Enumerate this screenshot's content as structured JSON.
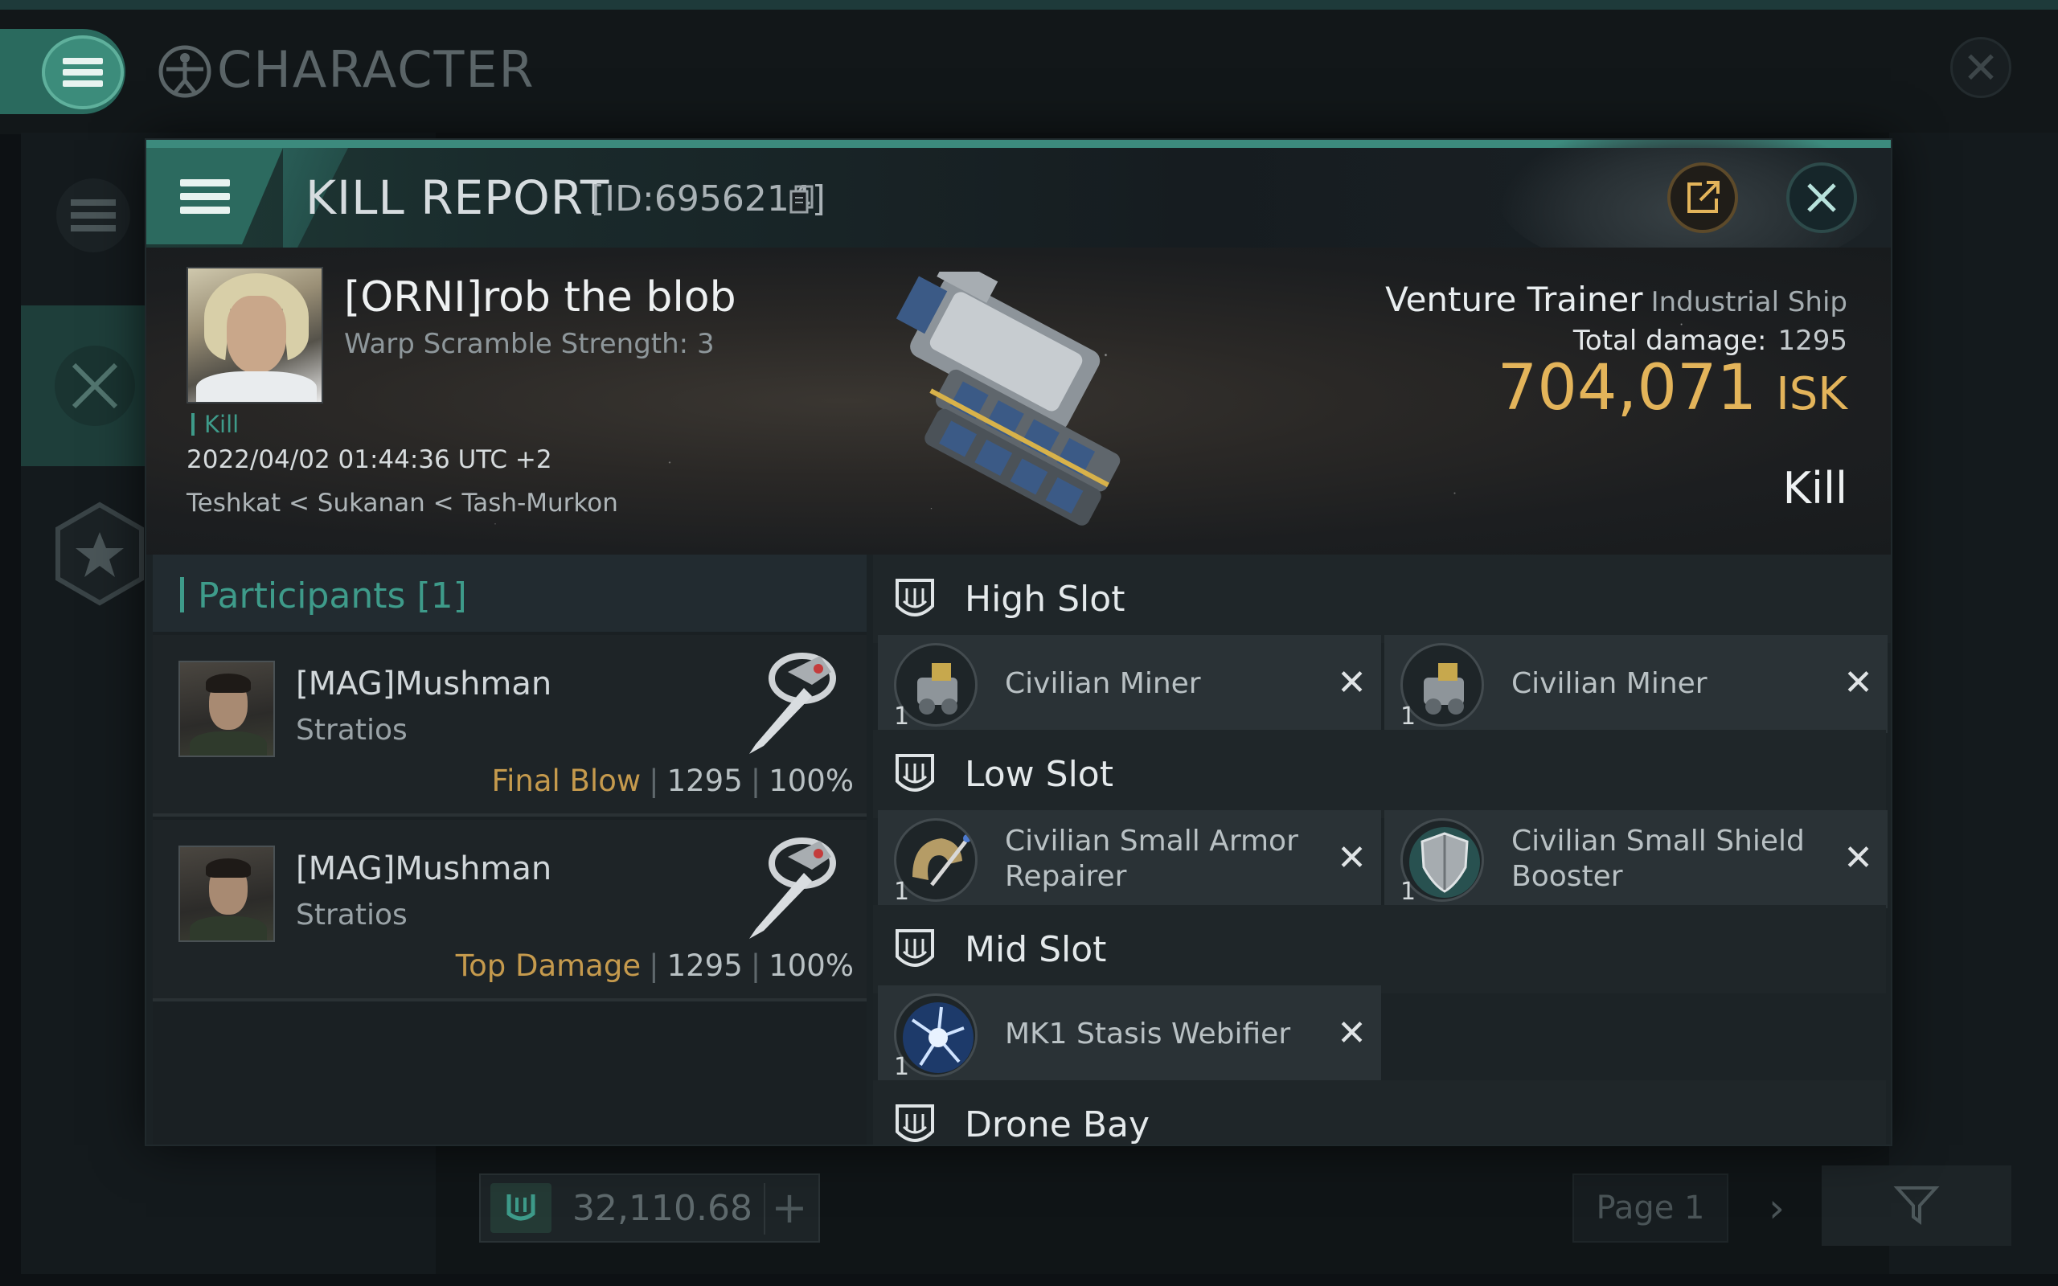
{
  "background_window": {
    "title": "CHARACTER",
    "wallet_amount": "32,110.68",
    "page_label": "Page 1"
  },
  "kill_report": {
    "title": "KILL REPORT",
    "id_label": "[ID:6956214]",
    "victim": {
      "name": "[ORNI]rob the blob",
      "subtitle": "Warp Scramble Strength: 3",
      "kill_tag": "Kill",
      "datetime": "2022/04/02 01:44:36 UTC +2",
      "location": "Teshkat < Sukanan < Tash-Murkon"
    },
    "ship": {
      "name": "Venture Trainer",
      "class": "Industrial Ship",
      "total_damage_label": "Total damage:",
      "total_damage_value": "1295",
      "isk_value": "704,071",
      "isk_currency": "ISK",
      "result_label": "Kill"
    },
    "participants": {
      "header": "Participants [1]",
      "rows": [
        {
          "name": "[MAG]Mushman",
          "ship": "Stratios",
          "tag": "Final Blow",
          "damage": "1295",
          "percent": "100%"
        },
        {
          "name": "[MAG]Mushman",
          "ship": "Stratios",
          "tag": "Top Damage",
          "damage": "1295",
          "percent": "100%"
        }
      ]
    },
    "fitting": {
      "high_slot": {
        "label": "High Slot",
        "modules": [
          {
            "name": "Civilian Miner",
            "qty": "1",
            "icon": "miner-icon"
          },
          {
            "name": "Civilian Miner",
            "qty": "1",
            "icon": "miner-icon"
          }
        ]
      },
      "low_slot": {
        "label": "Low Slot",
        "modules": [
          {
            "name": "Civilian Small Armor Repairer",
            "qty": "1",
            "icon": "armor-repairer-icon"
          },
          {
            "name": "Civilian Small Shield Booster",
            "qty": "1",
            "icon": "shield-booster-icon"
          }
        ]
      },
      "mid_slot": {
        "label": "Mid Slot",
        "modules": [
          {
            "name": "MK1 Stasis Webifier",
            "qty": "1",
            "icon": "stasis-webifier-icon"
          }
        ]
      },
      "drone_bay": {
        "label": "Drone Bay"
      }
    }
  },
  "colors": {
    "accent_teal": "#3e9b8a",
    "isk_gold": "#e3b45a",
    "final_blow": "#c59a4d"
  }
}
